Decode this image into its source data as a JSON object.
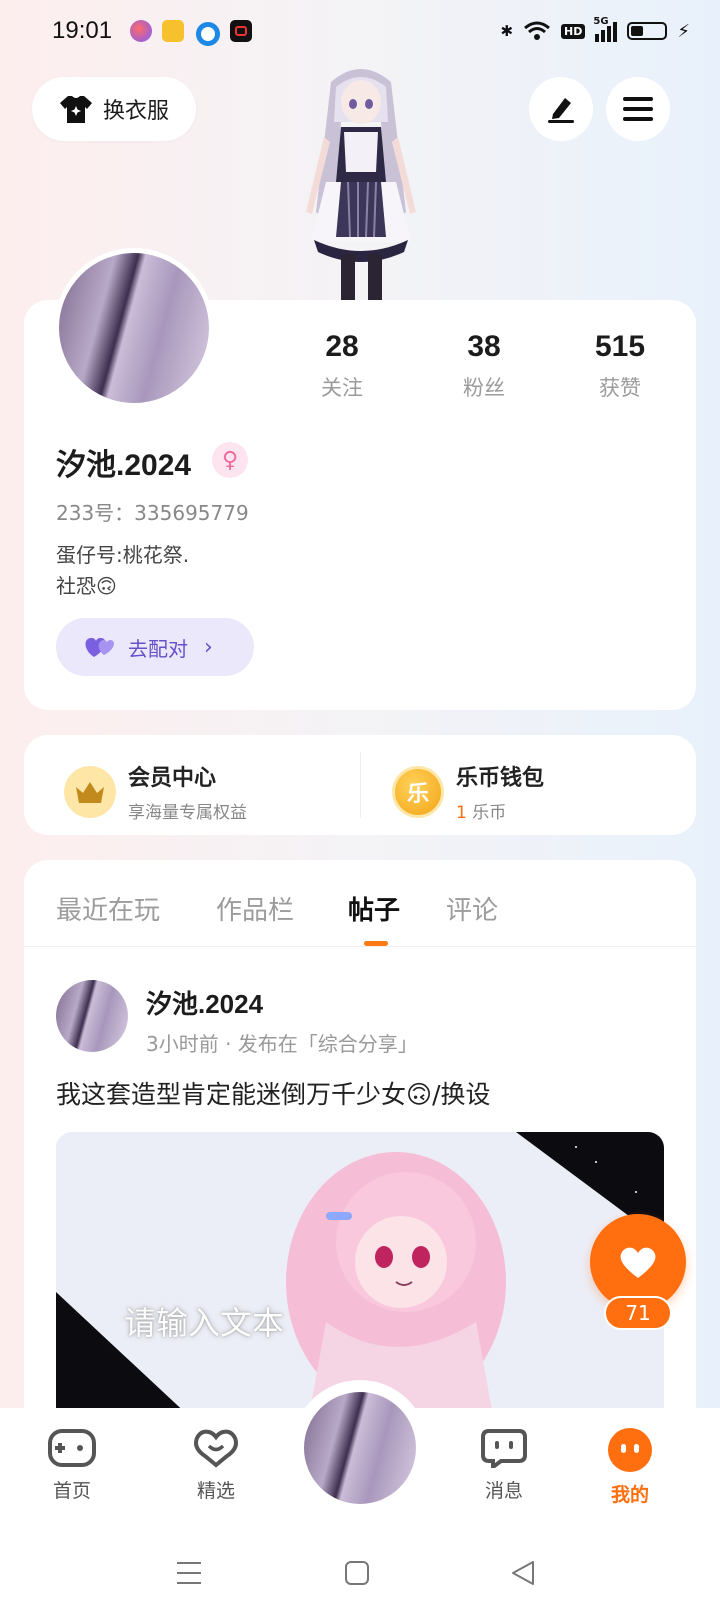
{
  "status_bar": {
    "time": "19:01",
    "hd_label": "HD",
    "network_label": "5G"
  },
  "top_bar": {
    "outfit_label": "换衣服"
  },
  "profile": {
    "stats": [
      {
        "value": "28",
        "label": "关注"
      },
      {
        "value": "38",
        "label": "粉丝"
      },
      {
        "value": "515",
        "label": "获赞"
      }
    ],
    "username": "汐池.2024",
    "gender_symbol": "♀",
    "id_line": "233号：335695779",
    "bio_line1": "蛋仔号:桃花祭.",
    "bio_line2": "社恐🙃",
    "match_label": "去配对"
  },
  "member": {
    "title": "会员中心",
    "subtitle": "享海量专属权益",
    "crown_icon": "crown-icon"
  },
  "wallet": {
    "title": "乐币钱包",
    "coin_glyph": "乐",
    "amount": "1",
    "unit": " 乐币"
  },
  "tabs": [
    {
      "label": "最近在玩",
      "active": false
    },
    {
      "label": "作品栏",
      "active": false
    },
    {
      "label": "帖子",
      "active": true
    },
    {
      "label": "评论",
      "active": false
    }
  ],
  "post": {
    "author": "汐池.2024",
    "meta": "3小时前 · 发布在「综合分享」",
    "text": "我这套造型肯定能迷倒万千少女🙃/换设",
    "image_overlay_text": "请输入文本",
    "like_count": "71"
  },
  "bottom_nav": [
    {
      "label": "首页",
      "icon": "gamepad-icon"
    },
    {
      "label": "精选",
      "icon": "heart-chat-icon"
    },
    {
      "label": "消息",
      "icon": "message-icon"
    },
    {
      "label": "我的",
      "icon": "face-icon",
      "active": true
    }
  ],
  "colors": {
    "accent": "#ff6f0f",
    "match": "#6750c9",
    "gold": "#f5b93a"
  }
}
